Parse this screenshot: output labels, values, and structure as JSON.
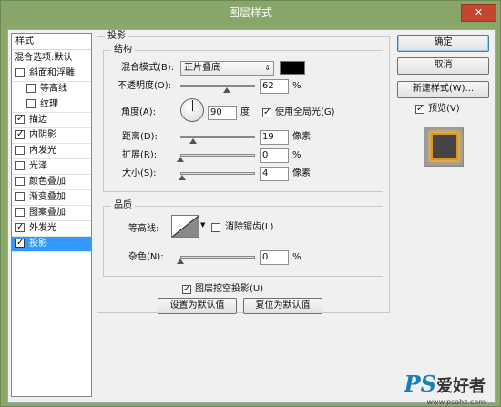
{
  "window": {
    "title": "图层样式",
    "close": "✕"
  },
  "sidebar": {
    "header": "样式",
    "blend_options": "混合选项:默认",
    "items": [
      {
        "label": "斜面和浮雕",
        "checked": false,
        "sub": false,
        "active": false
      },
      {
        "label": "等高线",
        "checked": false,
        "sub": true,
        "active": false
      },
      {
        "label": "纹理",
        "checked": false,
        "sub": true,
        "active": false
      },
      {
        "label": "描边",
        "checked": true,
        "sub": false,
        "active": false
      },
      {
        "label": "内阴影",
        "checked": true,
        "sub": false,
        "active": false
      },
      {
        "label": "内发光",
        "checked": false,
        "sub": false,
        "active": false
      },
      {
        "label": "光泽",
        "checked": false,
        "sub": false,
        "active": false
      },
      {
        "label": "颜色叠加",
        "checked": false,
        "sub": false,
        "active": false
      },
      {
        "label": "渐变叠加",
        "checked": false,
        "sub": false,
        "active": false
      },
      {
        "label": "图案叠加",
        "checked": false,
        "sub": false,
        "active": false
      },
      {
        "label": "外发光",
        "checked": true,
        "sub": false,
        "active": false
      },
      {
        "label": "投影",
        "checked": true,
        "sub": false,
        "active": true
      }
    ]
  },
  "panel": {
    "title": "投影",
    "structure": {
      "title": "结构",
      "blend_mode_label": "混合模式(B):",
      "blend_mode_value": "正片叠底",
      "shadow_color": "#000000",
      "opacity_label": "不透明度(O):",
      "opacity_value": "62",
      "opacity_fraction": 0.62,
      "percent": "%",
      "angle_label": "角度(A):",
      "angle_value": "90",
      "angle_unit": "度",
      "global_light_label": "使用全局光(G)",
      "global_light_checked": true,
      "distance_label": "距离(D):",
      "distance_value": "19",
      "distance_unit": "像素",
      "spread_label": "扩展(R):",
      "spread_value": "0",
      "size_label": "大小(S):",
      "size_value": "4",
      "size_unit": "像素"
    },
    "quality": {
      "title": "品质",
      "contour_label": "等高线:",
      "anti_alias_label": "消除锯齿(L)",
      "anti_alias_checked": false,
      "noise_label": "杂色(N):",
      "noise_value": "0",
      "percent": "%"
    },
    "knockout_label": "图层挖空投影(U)",
    "knockout_checked": true,
    "make_default": "设置为默认值",
    "reset_default": "复位为默认值"
  },
  "actions": {
    "ok": "确定",
    "cancel": "取消",
    "new_style": "新建样式(W)...",
    "preview_label": "预览(V)",
    "preview_checked": true
  },
  "watermark": {
    "ps": "PS",
    "cn": "爱好者",
    "url": "www.psahz.com"
  },
  "colors": {
    "accent": "#3399ff",
    "titlebar": "#89a66a",
    "close": "#c3462e",
    "preview_glow": "#f0b43c"
  }
}
